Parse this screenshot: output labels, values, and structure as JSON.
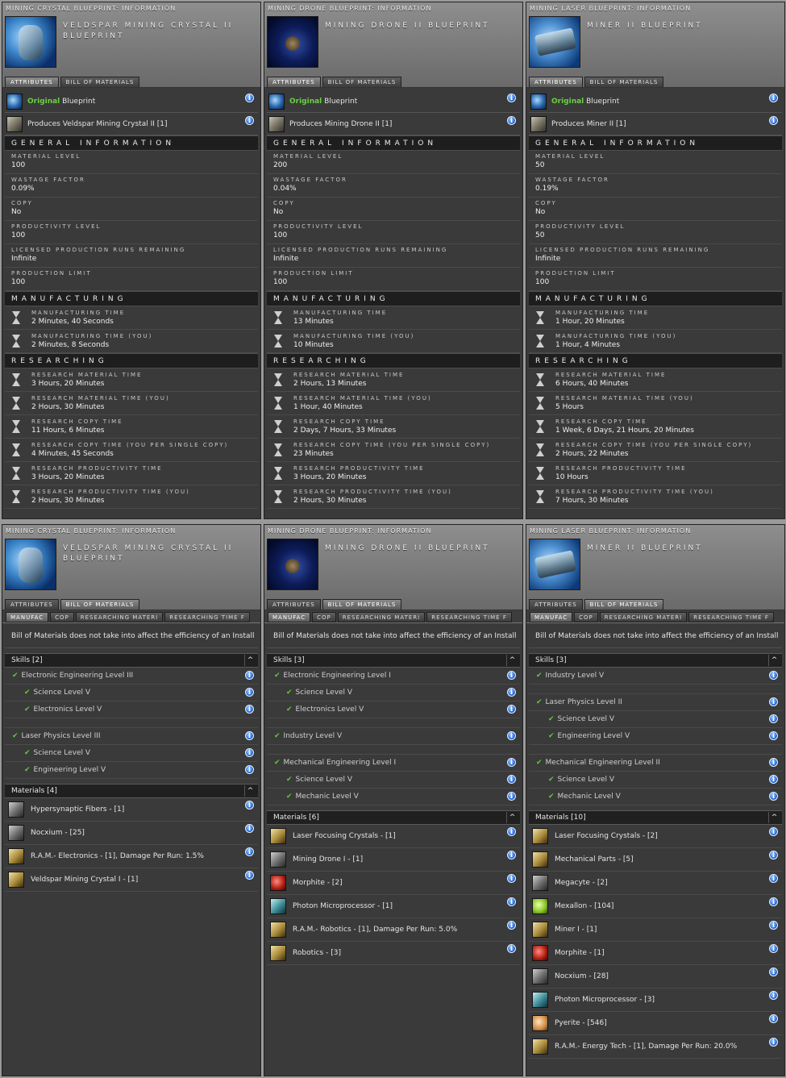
{
  "colors": {
    "original_green": "#69d241",
    "info_blue": "#2b6fd6",
    "section_bg": "#1e1e1e"
  },
  "attr_windows": [
    {
      "caption": "Mining Crystal Blueprint: Information",
      "title": "Veldspar Mining Crystal II Blueprint",
      "icon": "crystal-icon",
      "tabs": [
        "Attributes",
        "Bill of Materials"
      ],
      "original_word": "Original",
      "blueprint_word": "Blueprint",
      "produces": "Produces Veldspar Mining Crystal II [1]",
      "sections": {
        "general": "General Information",
        "manufacturing": "Manufacturing",
        "researching": "Researching"
      },
      "general": [
        {
          "label": "Material Level",
          "value": "100"
        },
        {
          "label": "Wastage Factor",
          "value": "0.09%"
        },
        {
          "label": "Copy",
          "value": "No"
        },
        {
          "label": "Productivity Level",
          "value": "100"
        },
        {
          "label": "Licensed Production Runs Remaining",
          "value": "Infinite"
        },
        {
          "label": "Production Limit",
          "value": "100"
        }
      ],
      "manufacturing": [
        {
          "label": "Manufacturing Time",
          "value": "2 Minutes, 40 Seconds"
        },
        {
          "label": "Manufacturing Time (You)",
          "value": "2 Minutes, 8 Seconds"
        }
      ],
      "researching": [
        {
          "label": "Research Material Time",
          "value": "3 Hours, 20 Minutes"
        },
        {
          "label": "Research Material Time (You)",
          "value": "2 Hours, 30 Minutes"
        },
        {
          "label": "Research Copy Time",
          "value": "11 Hours, 6 Minutes"
        },
        {
          "label": "Research Copy Time (You per single copy)",
          "value": "4 Minutes, 45 Seconds"
        },
        {
          "label": "Research Productivity Time",
          "value": "3 Hours, 20 Minutes"
        },
        {
          "label": "Research Productivity Time (You)",
          "value": "2 Hours, 30 Minutes"
        }
      ]
    },
    {
      "caption": "Mining Drone Blueprint: Information",
      "title": "Mining Drone II Blueprint",
      "icon": "drone-icon",
      "tabs": [
        "Attributes",
        "Bill of Materials"
      ],
      "original_word": "Original",
      "blueprint_word": "Blueprint",
      "produces": "Produces Mining Drone II [1]",
      "sections": {
        "general": "General Information",
        "manufacturing": "Manufacturing",
        "researching": "Researching"
      },
      "general": [
        {
          "label": "Material Level",
          "value": "200"
        },
        {
          "label": "Wastage Factor",
          "value": "0.04%"
        },
        {
          "label": "Copy",
          "value": "No"
        },
        {
          "label": "Productivity Level",
          "value": "100"
        },
        {
          "label": "Licensed Production Runs Remaining",
          "value": "Infinite"
        },
        {
          "label": "Production Limit",
          "value": "100"
        }
      ],
      "manufacturing": [
        {
          "label": "Manufacturing Time",
          "value": "13 Minutes"
        },
        {
          "label": "Manufacturing Time (You)",
          "value": "10 Minutes"
        }
      ],
      "researching": [
        {
          "label": "Research Material Time",
          "value": "2 Hours, 13 Minutes"
        },
        {
          "label": "Research Material Time (You)",
          "value": "1 Hour, 40 Minutes"
        },
        {
          "label": "Research Copy Time",
          "value": "2 Days, 7 Hours, 33 Minutes"
        },
        {
          "label": "Research Copy Time (You per single copy)",
          "value": "23 Minutes"
        },
        {
          "label": "Research Productivity Time",
          "value": "3 Hours, 20 Minutes"
        },
        {
          "label": "Research Productivity Time (You)",
          "value": "2 Hours, 30 Minutes"
        }
      ]
    },
    {
      "caption": "Mining Laser Blueprint: Information",
      "title": "Miner II Blueprint",
      "icon": "laser-icon",
      "tabs": [
        "Attributes",
        "Bill of Materials"
      ],
      "original_word": "Original",
      "blueprint_word": "Blueprint",
      "produces": "Produces Miner II [1]",
      "sections": {
        "general": "General Information",
        "manufacturing": "Manufacturing",
        "researching": "Researching"
      },
      "general": [
        {
          "label": "Material Level",
          "value": "50"
        },
        {
          "label": "Wastage Factor",
          "value": "0.19%"
        },
        {
          "label": "Copy",
          "value": "No"
        },
        {
          "label": "Productivity Level",
          "value": "50"
        },
        {
          "label": "Licensed Production Runs Remaining",
          "value": "Infinite"
        },
        {
          "label": "Production Limit",
          "value": "100"
        }
      ],
      "manufacturing": [
        {
          "label": "Manufacturing Time",
          "value": "1 Hour, 20 Minutes"
        },
        {
          "label": "Manufacturing Time (You)",
          "value": "1 Hour, 4 Minutes"
        }
      ],
      "researching": [
        {
          "label": "Research Material Time",
          "value": "6 Hours, 40 Minutes"
        },
        {
          "label": "Research Material Time (You)",
          "value": "5 Hours"
        },
        {
          "label": "Research Copy Time",
          "value": "1 Week, 6 Days, 21 Hours, 20 Minutes"
        },
        {
          "label": "Research Copy Time (You per single copy)",
          "value": "2 Hours, 22 Minutes"
        },
        {
          "label": "Research Productivity Time",
          "value": "10 Hours"
        },
        {
          "label": "Research Productivity Time (You)",
          "value": "7 Hours, 30 Minutes"
        }
      ]
    }
  ],
  "bom_windows": [
    {
      "caption": "Mining Crystal Blueprint: Information",
      "title": "Veldspar Mining Crystal II Blueprint",
      "tabs": [
        "Attributes",
        "Bill of Materials"
      ],
      "subtabs": [
        "Manufac",
        "Cop",
        "Researching Materi",
        "Researching Time f"
      ],
      "note": "Bill of Materials does not take into affect the efficiency of an Install",
      "skills_header": "Skills [2]",
      "skills": [
        {
          "name": "Electronic Engineering Level III",
          "level": 1
        },
        {
          "name": "Science Level V",
          "level": 2
        },
        {
          "name": "Electronics Level V",
          "level": 2
        },
        {
          "gap": true
        },
        {
          "name": "Laser Physics Level III",
          "level": 1
        },
        {
          "name": "Science Level V",
          "level": 2
        },
        {
          "name": "Engineering Level V",
          "level": 2
        }
      ],
      "materials_header": "Materials [4]",
      "materials": [
        {
          "name": "Hypersynaptic Fibers - [1]",
          "icon": "fiber-icon",
          "style": ""
        },
        {
          "name": "Nocxium - [25]",
          "icon": "mineral-icon",
          "style": ""
        },
        {
          "name": "R.A.M.- Electronics - [1], Damage Per Run: 1.5%",
          "icon": "ram-icon",
          "style": "gold"
        },
        {
          "name": "Veldspar Mining Crystal I - [1]",
          "icon": "crystal-icon",
          "style": "gold"
        }
      ]
    },
    {
      "caption": "Mining Drone Blueprint: Information",
      "title": "Mining Drone II Blueprint",
      "tabs": [
        "Attributes",
        "Bill of Materials"
      ],
      "subtabs": [
        "Manufac",
        "Cop",
        "Researching Materi",
        "Researching Time f"
      ],
      "note": "Bill of Materials does not take into affect the efficiency of an Install",
      "skills_header": "Skills [3]",
      "skills": [
        {
          "name": "Electronic Engineering Level I",
          "level": 1
        },
        {
          "name": "Science Level V",
          "level": 2
        },
        {
          "name": "Electronics Level V",
          "level": 2
        },
        {
          "gap": true
        },
        {
          "name": "Industry Level V",
          "level": 1
        },
        {
          "gap": true
        },
        {
          "name": "Mechanical Engineering Level I",
          "level": 1
        },
        {
          "name": "Science Level V",
          "level": 2
        },
        {
          "name": "Mechanic Level V",
          "level": 2
        }
      ],
      "materials_header": "Materials [6]",
      "materials": [
        {
          "name": "Laser Focusing Crystals - [1]",
          "icon": "crystal-icon",
          "style": "gold"
        },
        {
          "name": "Mining Drone I - [1]",
          "icon": "drone-icon",
          "style": ""
        },
        {
          "name": "Morphite - [2]",
          "icon": "mineral-icon",
          "style": "red"
        },
        {
          "name": "Photon Microprocessor - [1]",
          "icon": "chip-icon",
          "style": "cyan"
        },
        {
          "name": "R.A.M.- Robotics - [1], Damage Per Run: 5.0%",
          "icon": "ram-icon",
          "style": "gold"
        },
        {
          "name": "Robotics - [3]",
          "icon": "robotics-icon",
          "style": "gold"
        }
      ]
    },
    {
      "caption": "Mining Laser Blueprint: Information",
      "title": "Miner II Blueprint",
      "tabs": [
        "Attributes",
        "Bill of Materials"
      ],
      "subtabs": [
        "Manufac",
        "Cop",
        "Researching Materi",
        "Researching Time f"
      ],
      "note": "Bill of Materials does not take into affect the efficiency of an Install",
      "skills_header": "Skills [3]",
      "skills": [
        {
          "name": "Industry Level V",
          "level": 1
        },
        {
          "gap": true
        },
        {
          "name": "Laser Physics Level II",
          "level": 1
        },
        {
          "name": "Science Level V",
          "level": 2
        },
        {
          "name": "Engineering Level V",
          "level": 2
        },
        {
          "gap": true
        },
        {
          "name": "Mechanical Engineering Level II",
          "level": 1
        },
        {
          "name": "Science Level V",
          "level": 2
        },
        {
          "name": "Mechanic Level V",
          "level": 2
        }
      ],
      "materials_header": "Materials [10]",
      "materials": [
        {
          "name": "Laser Focusing Crystals - [2]",
          "icon": "crystal-icon",
          "style": "gold"
        },
        {
          "name": "Mechanical Parts - [5]",
          "icon": "parts-icon",
          "style": "gold"
        },
        {
          "name": "Megacyte - [2]",
          "icon": "mineral-icon",
          "style": ""
        },
        {
          "name": "Mexallon - [104]",
          "icon": "mineral-icon",
          "style": "green"
        },
        {
          "name": "Miner I - [1]",
          "icon": "laser-icon",
          "style": "gold"
        },
        {
          "name": "Morphite - [1]",
          "icon": "mineral-icon",
          "style": "red"
        },
        {
          "name": "Nocxium - [28]",
          "icon": "mineral-icon",
          "style": ""
        },
        {
          "name": "Photon Microprocessor - [3]",
          "icon": "chip-icon",
          "style": "cyan"
        },
        {
          "name": "Pyerite - [546]",
          "icon": "mineral-icon",
          "style": "orange"
        },
        {
          "name": "R.A.M.- Energy Tech - [1], Damage Per Run: 20.0%",
          "icon": "ram-icon",
          "style": "gold"
        }
      ]
    }
  ]
}
